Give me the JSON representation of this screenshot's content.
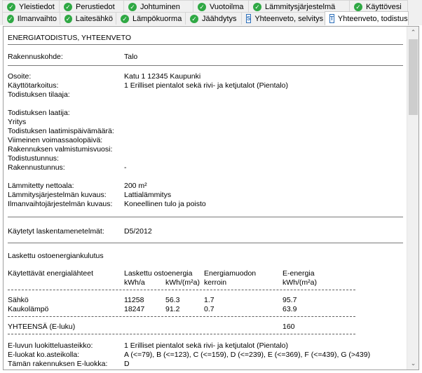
{
  "tabs": {
    "row1": [
      {
        "label": "Yleistiedot",
        "icon": "check-icon"
      },
      {
        "label": "Perustiedot",
        "icon": "check-icon"
      },
      {
        "label": "Johtuminen",
        "icon": "check-icon"
      },
      {
        "label": "Vuotoilma",
        "icon": "check-icon"
      },
      {
        "label": "Lämmitysjärjestelmä",
        "icon": "check-icon"
      },
      {
        "label": "Käyttövesi",
        "icon": "check-icon"
      }
    ],
    "row2": [
      {
        "label": "Ilmanvaihto",
        "icon": "check-icon"
      },
      {
        "label": "Laitesähkö",
        "icon": "check-icon"
      },
      {
        "label": "Lämpökuorma",
        "icon": "check-icon"
      },
      {
        "label": "Jäähdytys",
        "icon": "check-icon"
      },
      {
        "label": "Yhteenveto, selvitys",
        "icon": "doc-icon"
      },
      {
        "label": "Yhteenveto, todistus",
        "icon": "doc-icon",
        "active": true
      }
    ]
  },
  "report": {
    "title": "ENERGIATODISTUS, YHTEENVETO",
    "rakennuskohde_label": "Rakennuskohde:",
    "rakennuskohde_value": "Talo",
    "osoite_label": "Osoite:",
    "osoite_value": "Katu 1 12345 Kaupunki",
    "kayttotarkoitus_label": "Käyttötarkoitus:",
    "kayttotarkoitus_value": "1 Erilliset pientalot sekä rivi- ja ketjutalot (Pientalo)",
    "tilaaja_label": "Todistuksen tilaaja:",
    "laatija_label": "Todistuksen laatija:",
    "yritys_label": "Yritys",
    "laatimispaiva_label": "Todistuksen laatimispäivämäärä:",
    "voimassaolo_label": "Viimeinen voimassaolopäivä:",
    "valmistumisvuosi_label": "Rakennuksen valmistumisvuosi:",
    "todistustunnus_label": "Todistustunnus:",
    "rakennustunnus_label": "Rakennustunnus:",
    "rakennustunnus_value": "-",
    "nettoala_label": "Lämmitetty nettoala:",
    "nettoala_value": "200 m²",
    "lammitys_label": "Lämmitysjärjestelmän kuvaus:",
    "lammitys_value": "Lattialämmitys",
    "ilmanvaihto_label": "Ilmanvaihtojärjestelmän kuvaus:",
    "ilmanvaihto_value": "Koneellinen tulo ja poisto",
    "menetelmat_label": "Käytetyt laskentamenetelmät:",
    "menetelmat_value": "D5/2012",
    "ostoenergia_heading": "Laskettu ostoenergiankulutus",
    "col_lahteet": "Käytettävät energialähteet",
    "col_ostoenergia": "Laskettu ostoenergia",
    "col_kerroin": "Energiamuodon",
    "col_eenergia": "E-energia",
    "unit_kwha": "kWh/a",
    "unit_kwhm2a": "kWh/(m²a)",
    "unit_kerroin": "kerroin",
    "unit_e": "kWh/(m²a)",
    "rows": [
      {
        "source": "Sähkö",
        "kwha": "11258",
        "kwhm2": "56.3",
        "kerroin": "1.7",
        "e": "95.7"
      },
      {
        "source": "Kaukolämpö",
        "kwha": "18247",
        "kwhm2": "91.2",
        "kerroin": "0.7",
        "e": "63.9"
      }
    ],
    "total_label": "YHTEENSÄ (E-luku)",
    "total_value": "160",
    "luokitteluasteikko_label": "E-luvun luokitteluasteikko:",
    "luokitteluasteikko_value": "1 Erilliset pientalot sekä rivi- ja ketjutalot (Pientalo)",
    "eluokat_label": "E-luokat ko.asteikolla:",
    "eluokat_value": "A (<=79), B (<=123), C (<=159), D (<=239), E (<=369), F (<=439), G (>439)",
    "oma_luokka_label": "Tämän rakennuksen E-luokka:",
    "oma_luokka_value": "D"
  }
}
